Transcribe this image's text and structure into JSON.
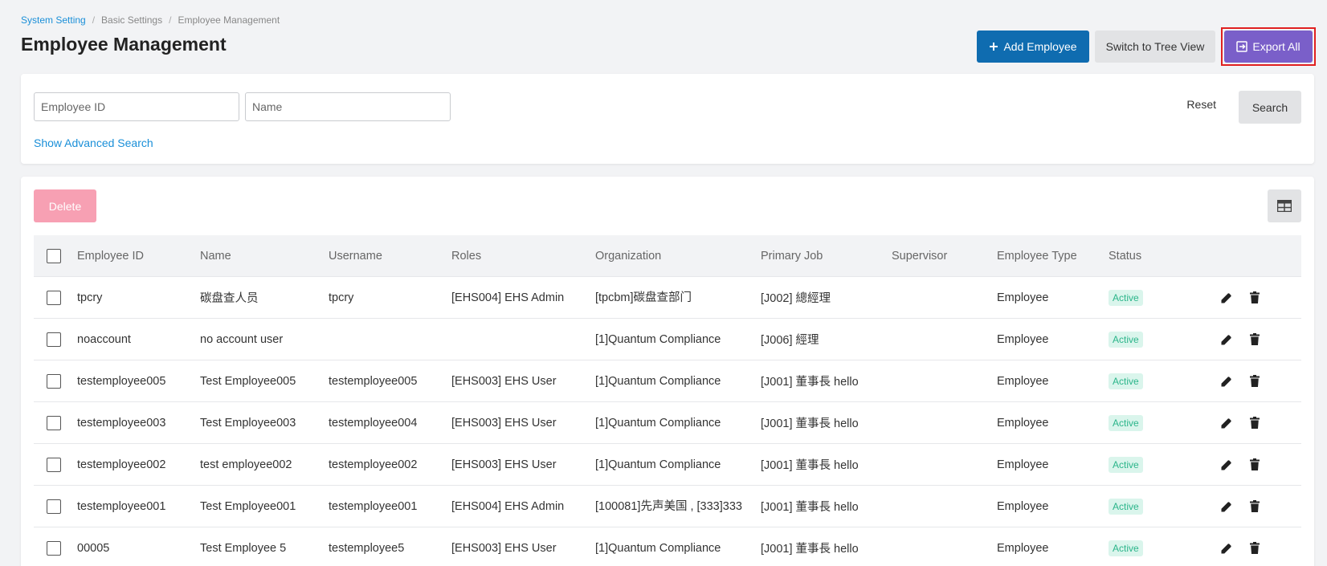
{
  "breadcrumb": {
    "items": [
      "System Setting",
      "Basic Settings",
      "Employee Management"
    ],
    "separator": "/"
  },
  "page_title": "Employee Management",
  "header": {
    "add_label": "Add Employee",
    "tree_label": "Switch to Tree View",
    "export_label": "Export All"
  },
  "search": {
    "employee_id_placeholder": "Employee ID",
    "name_placeholder": "Name",
    "advanced_link": "Show Advanced Search",
    "reset_label": "Reset",
    "search_label": "Search"
  },
  "table": {
    "delete_label": "Delete",
    "columns": [
      "Employee ID",
      "Name",
      "Username",
      "Roles",
      "Organization",
      "Primary Job",
      "Supervisor",
      "Employee Type",
      "Status"
    ],
    "rows": [
      {
        "id": "tpcry",
        "name": "碳盘查人员",
        "username": "tpcry",
        "roles": "[EHS004] EHS Admin",
        "org": "[tpcbm]碳盘查部门",
        "job": "[J002] 總經理",
        "supervisor": "",
        "type": "Employee",
        "status": "Active"
      },
      {
        "id": "noaccount",
        "name": "no account user",
        "username": "",
        "roles": "",
        "org": "[1]Quantum Compliance",
        "job": "[J006] 經理",
        "supervisor": "",
        "type": "Employee",
        "status": "Active"
      },
      {
        "id": "testemployee005",
        "name": "Test Employee005",
        "username": "testemployee005",
        "roles": "[EHS003] EHS User",
        "org": "[1]Quantum Compliance",
        "job": "[J001] 董事長 hello",
        "supervisor": "",
        "type": "Employee",
        "status": "Active"
      },
      {
        "id": "testemployee003",
        "name": "Test Employee003",
        "username": "testemployee004",
        "roles": "[EHS003] EHS User",
        "org": "[1]Quantum Compliance",
        "job": "[J001] 董事長 hello",
        "supervisor": "",
        "type": "Employee",
        "status": "Active"
      },
      {
        "id": "testemployee002",
        "name": "test employee002",
        "username": "testemployee002",
        "roles": "[EHS003] EHS User",
        "org": "[1]Quantum Compliance",
        "job": "[J001] 董事長 hello",
        "supervisor": "",
        "type": "Employee",
        "status": "Active"
      },
      {
        "id": "testemployee001",
        "name": "Test Employee001",
        "username": "testemployee001",
        "roles": "[EHS004] EHS Admin",
        "org": "[100081]先声美国 , [333]333",
        "job": "[J001] 董事長 hello",
        "supervisor": "",
        "type": "Employee",
        "status": "Active"
      },
      {
        "id": "00005",
        "name": "Test Employee 5",
        "username": "testemployee5",
        "roles": "[EHS003] EHS User",
        "org": "[1]Quantum Compliance",
        "job": "[J001] 董事長 hello",
        "supervisor": "",
        "type": "Employee",
        "status": "Active"
      }
    ]
  },
  "icons": {
    "add": "plus-icon",
    "export": "export-icon",
    "columns": "table-columns-icon",
    "edit": "pencil-icon",
    "delete": "trash-icon"
  },
  "colors": {
    "primary": "#0f6cb0",
    "export": "#7a5fc9",
    "link": "#1a8fd8",
    "delete_disabled": "#f7a0b3",
    "status_active_bg": "#daf5ec",
    "status_active_text": "#2bb58a",
    "highlight_border": "#e02020"
  }
}
